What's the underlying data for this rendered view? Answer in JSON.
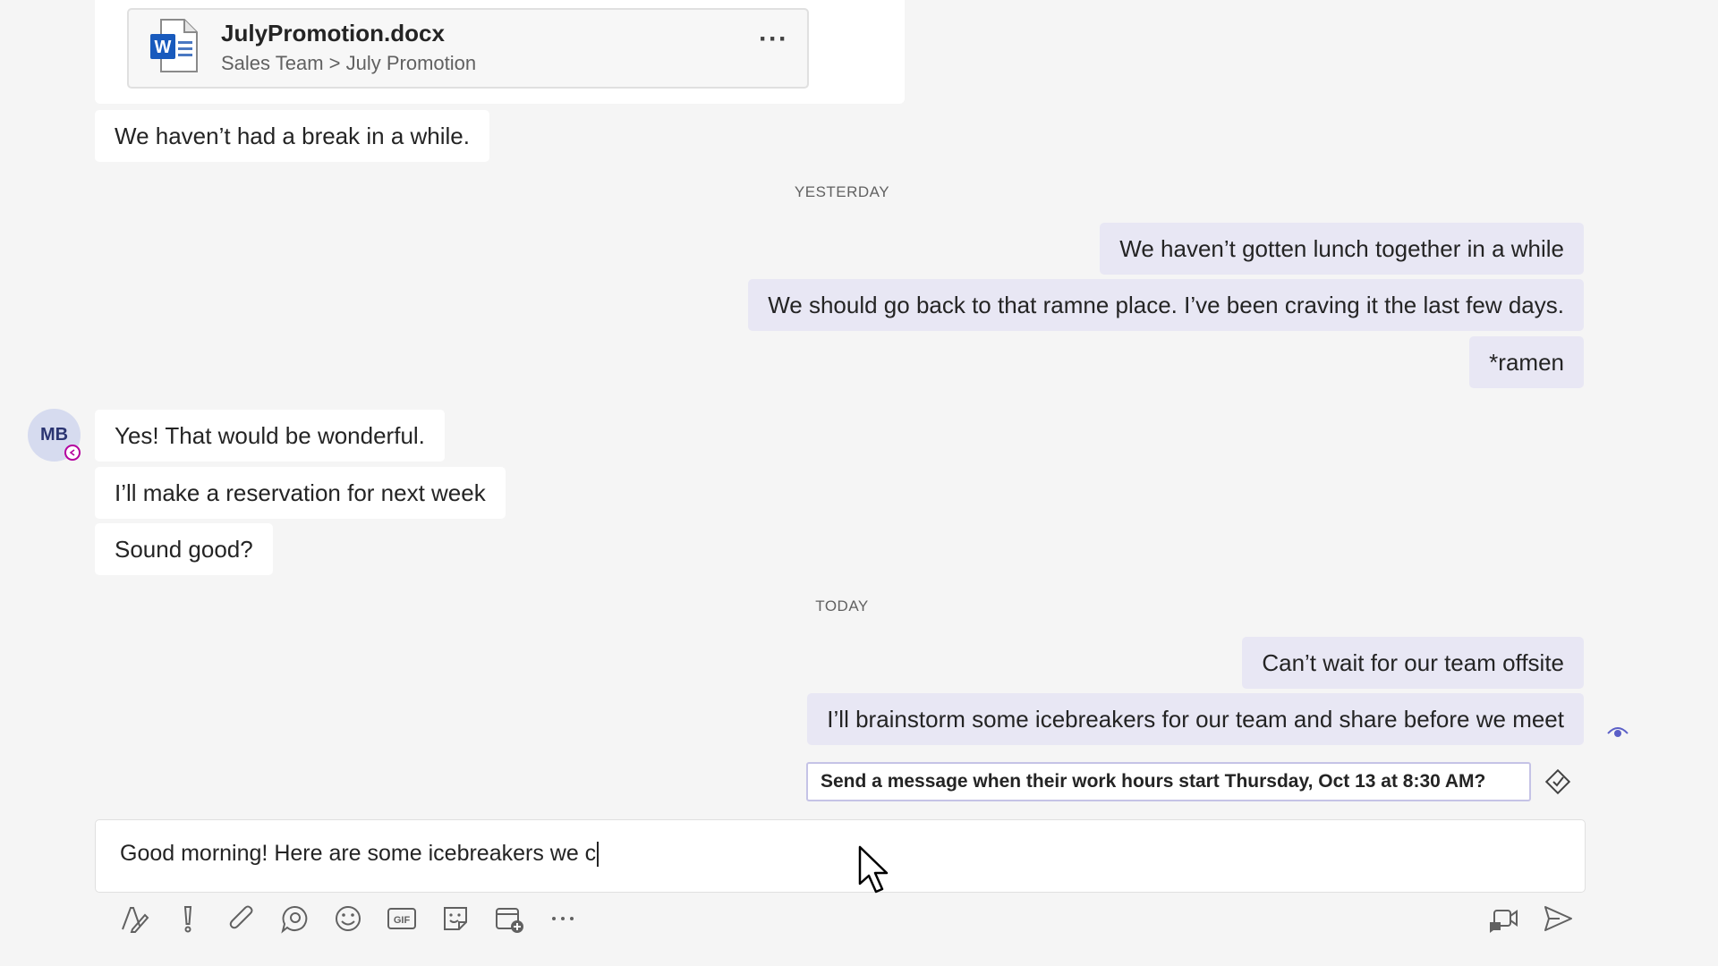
{
  "file_card": {
    "name": "JulyPromotion.docx",
    "path": "Sales Team > July Promotion",
    "more": "···",
    "icon": "word-doc-icon"
  },
  "messages_before": [
    {
      "text": "We haven’t had a break in a while."
    }
  ],
  "dividers": {
    "yesterday": "YESTERDAY",
    "today": "TODAY"
  },
  "yesterday_outgoing": [
    {
      "text": "We haven’t gotten lunch together in a while"
    },
    {
      "text": "We should go back to that ramne place. I’ve been craving it the last few days."
    },
    {
      "text": "*ramen"
    }
  ],
  "contact": {
    "initials": "MB",
    "status_color": "#b4009e"
  },
  "yesterday_incoming": [
    {
      "text": "Yes! That would be wonderful."
    },
    {
      "text": "I’ll make a reservation for next week"
    },
    {
      "text": "Sound good?"
    }
  ],
  "today_outgoing": [
    {
      "text": "Can’t wait for our team offsite"
    },
    {
      "text": "I’ll brainstorm some icebreakers for our team and share before we meet"
    }
  ],
  "schedule_prompt": "Send a message when their work hours start Thursday, Oct 13 at 8:30 AM?",
  "compose": {
    "text": "Good morning! Here are some icebreakers we c"
  },
  "toolbar": [
    "format-icon",
    "important-icon",
    "attach-icon",
    "loop-icon",
    "emoji-icon",
    "gif-icon",
    "sticker-icon",
    "schedule-meeting-icon",
    "more-options-icon",
    "video-message-icon",
    "send-icon"
  ],
  "colors": {
    "accent": "#5b5fc7",
    "outgoing_bubble": "#e8e7f4",
    "incoming_bubble": "#ffffff",
    "background": "#f5f5f5"
  }
}
